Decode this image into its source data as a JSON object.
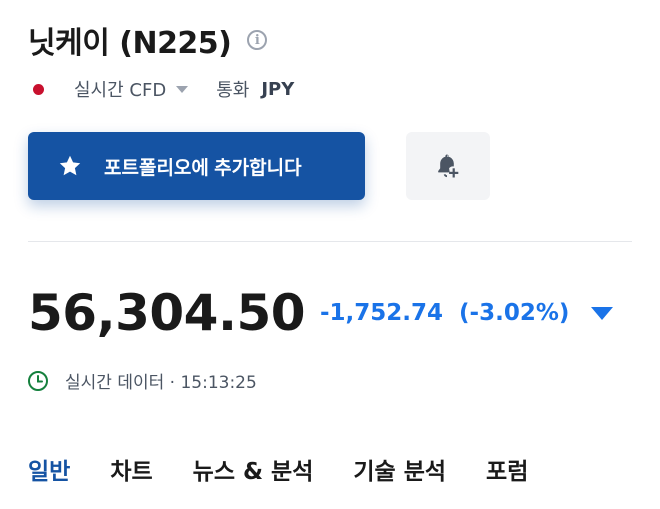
{
  "header": {
    "title": "닛케이 (N225)",
    "info_icon": "info-icon",
    "mode": "실시간 CFD",
    "currency_label": "통화",
    "currency": "JPY",
    "flag_color": "#c8102e"
  },
  "actions": {
    "portfolio_label": "포트폴리오에 추가합니다",
    "portfolio_icon": "star-icon",
    "alert_icon": "bell-plus-icon"
  },
  "quote": {
    "price": "56,304.50",
    "change": "-1,752.74",
    "change_pct": "(-3.02%)",
    "direction": "down",
    "color_down": "#1a73e8",
    "realtime_text": "실시간 데이터 · 15:13:25"
  },
  "tabs": [
    {
      "label": "일반",
      "active": true
    },
    {
      "label": "차트",
      "active": false
    },
    {
      "label": "뉴스 & 분석",
      "active": false
    },
    {
      "label": "기술 분석",
      "active": false
    },
    {
      "label": "포럼",
      "active": false
    }
  ],
  "colors": {
    "accent": "#1553a3"
  }
}
